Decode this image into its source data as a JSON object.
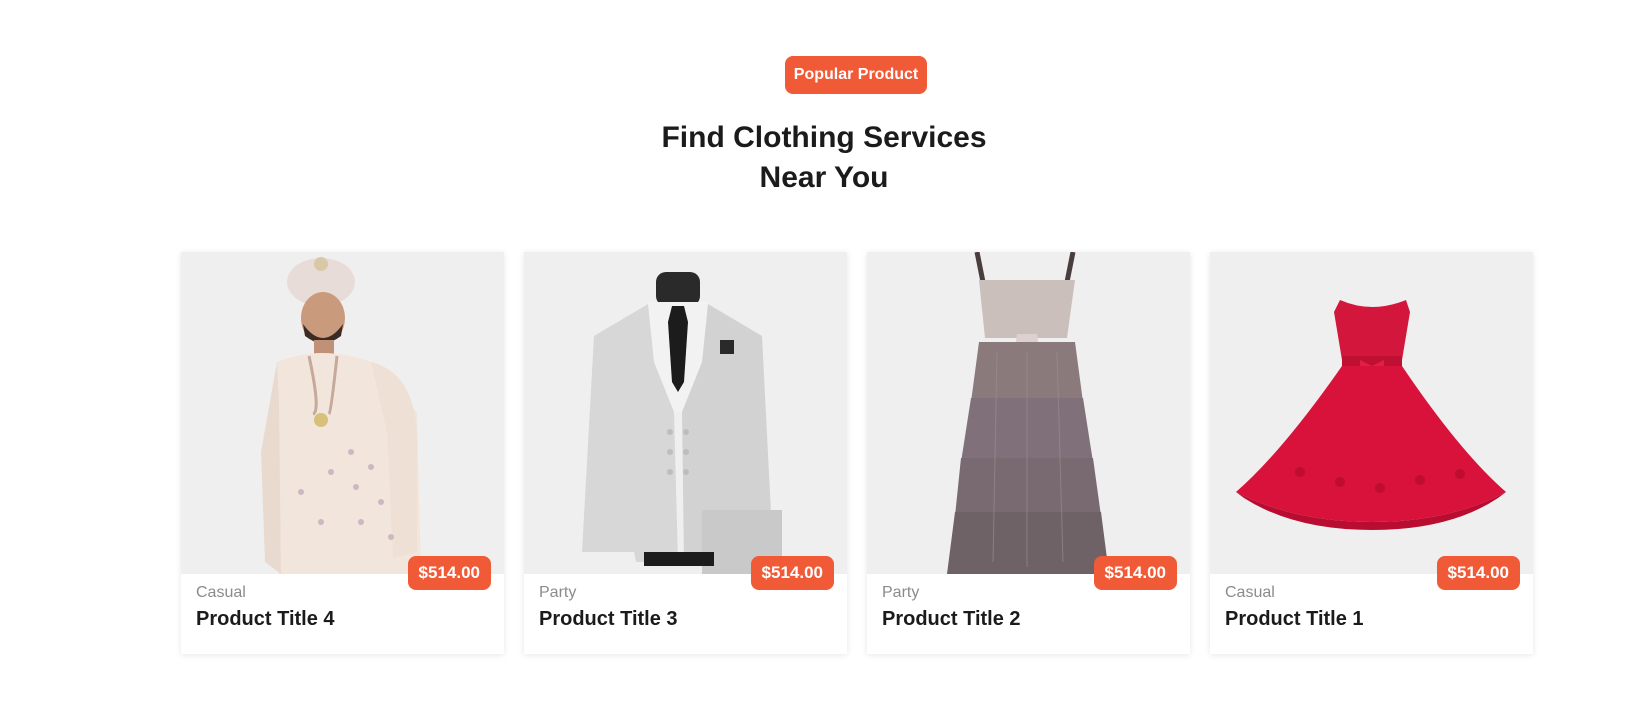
{
  "section": {
    "badge": "Popular Product",
    "heading_line1": "Find Clothing Services",
    "heading_line2": "Near You"
  },
  "products": [
    {
      "category": "Casual",
      "title": "Product Title 4",
      "price": "$514.00",
      "image": "sherwani-image"
    },
    {
      "category": "Party",
      "title": "Product Title 3",
      "price": "$514.00",
      "image": "suit-image"
    },
    {
      "category": "Party",
      "title": "Product Title 2",
      "price": "$514.00",
      "image": "tiered-dress-image"
    },
    {
      "category": "Casual",
      "title": "Product Title 1",
      "price": "$514.00",
      "image": "red-dress-image"
    }
  ],
  "colors": {
    "accent": "#f15a36",
    "heading": "#1b1b1b",
    "muted": "#8b8b8b",
    "card_image_bg": "#efefef"
  }
}
